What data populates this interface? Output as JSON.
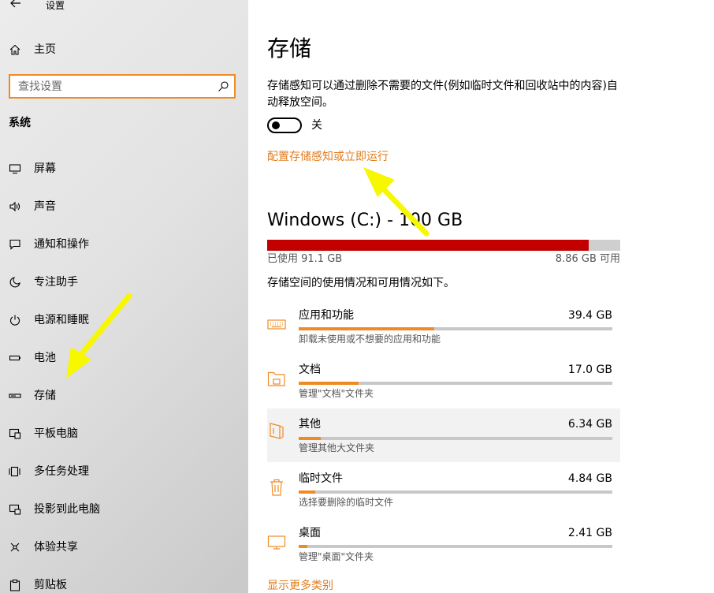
{
  "app": {
    "title": "设置",
    "back_icon": "back-arrow-icon"
  },
  "sidebar": {
    "home_label": "主页",
    "search_placeholder": "查找设置",
    "section": "系统",
    "items": [
      {
        "label": "屏幕",
        "icon": "monitor-icon"
      },
      {
        "label": "声音",
        "icon": "speaker-icon"
      },
      {
        "label": "通知和操作",
        "icon": "notification-icon"
      },
      {
        "label": "专注助手",
        "icon": "moon-icon"
      },
      {
        "label": "电源和睡眠",
        "icon": "power-icon"
      },
      {
        "label": "电池",
        "icon": "battery-icon"
      },
      {
        "label": "存储",
        "icon": "storage-drive-icon"
      },
      {
        "label": "平板电脑",
        "icon": "tablet-icon"
      },
      {
        "label": "多任务处理",
        "icon": "multitask-icon"
      },
      {
        "label": "投影到此电脑",
        "icon": "project-icon"
      },
      {
        "label": "体验共享",
        "icon": "share-icon"
      },
      {
        "label": "剪贴板",
        "icon": "clipboard-icon"
      }
    ],
    "selected": "存储"
  },
  "main": {
    "title": "存储",
    "description": "存储感知可以通过删除不需要的文件(例如临时文件和回收站中的内容)自动释放空间。",
    "toggle": {
      "state_label": "关",
      "on": false
    },
    "config_link": "配置存储感知或立即运行",
    "drive": {
      "title": "Windows (C:) - 100 GB",
      "used_label": "已使用 91.1 GB",
      "free_label": "8.86 GB 可用",
      "used_fraction": 0.911
    },
    "usage_description": "存储空间的使用情况和可用情况如下。",
    "categories": [
      {
        "name": "应用和功能",
        "size": "39.4 GB",
        "sub": "卸载未使用或不想要的应用和功能",
        "fraction": 0.432,
        "icon": "keyboard-icon"
      },
      {
        "name": "文档",
        "size": "17.0 GB",
        "sub": "管理\"文档\"文件夹",
        "fraction": 0.19,
        "icon": "folder-icon"
      },
      {
        "name": "其他",
        "size": "6.34 GB",
        "sub": "管理其他大文件夹",
        "fraction": 0.07,
        "icon": "other-file-icon"
      },
      {
        "name": "临时文件",
        "size": "4.84 GB",
        "sub": "选择要删除的临时文件",
        "fraction": 0.053,
        "icon": "trash-icon"
      },
      {
        "name": "桌面",
        "size": "2.41 GB",
        "sub": "管理\"桌面\"文件夹",
        "fraction": 0.028,
        "icon": "desktop-icon"
      }
    ],
    "highlighted_category": "其他",
    "more_link": "显示更多类别"
  },
  "colors": {
    "accent": "#f08a24",
    "link": "#e07c1f",
    "drive_used": "#c30000",
    "annotation_arrow": "#f7f700"
  }
}
